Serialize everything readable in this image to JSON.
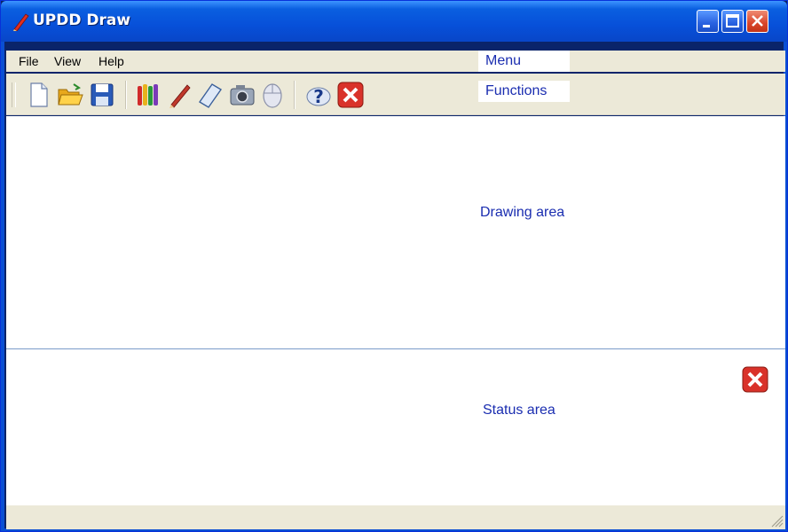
{
  "window": {
    "title": "UPDD Draw"
  },
  "menu": {
    "items": [
      "File",
      "View",
      "Help"
    ],
    "label": "Menu"
  },
  "toolbar": {
    "label": "Functions",
    "icons": [
      "new-document-icon",
      "open-folder-icon",
      "save-icon",
      "colors-icon",
      "pen-icon",
      "eraser-icon",
      "camera-icon",
      "mouse-icon",
      "help-icon",
      "close-icon"
    ]
  },
  "drawing": {
    "label": "Drawing area"
  },
  "status": {
    "label": "Status area"
  },
  "colors": {
    "accent": "#1a2db0",
    "titlebar": "#0750d9",
    "close": "#d9452a"
  }
}
